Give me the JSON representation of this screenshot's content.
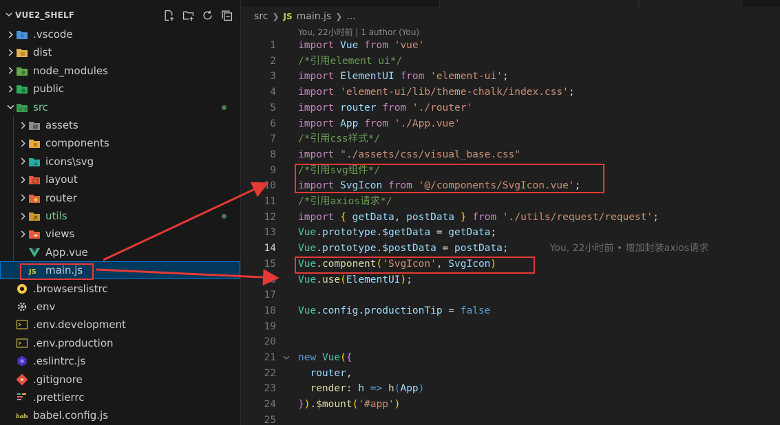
{
  "explorer": {
    "title": "VUE2_SHELF",
    "actions": [
      "new-file-icon",
      "new-folder-icon",
      "refresh-icon",
      "collapse-all-icon"
    ],
    "items": [
      {
        "label": ".vscode",
        "icon": "vscode-folder-icon",
        "twisty": "closed",
        "indent": 0
      },
      {
        "label": "dist",
        "icon": "dist-folder-icon",
        "twisty": "closed",
        "indent": 0
      },
      {
        "label": "node_modules",
        "icon": "node-folder-icon",
        "twisty": "closed",
        "indent": 0
      },
      {
        "label": "public",
        "icon": "public-folder-icon",
        "twisty": "closed",
        "indent": 0
      },
      {
        "label": "src",
        "icon": "src-folder-icon",
        "twisty": "open",
        "indent": 0,
        "modified": true
      },
      {
        "label": "assets",
        "icon": "assets-folder-icon",
        "twisty": "closed",
        "indent": 1
      },
      {
        "label": "components",
        "icon": "components-folder-icon",
        "twisty": "closed",
        "indent": 1
      },
      {
        "label": "icons\\svg",
        "icon": "icons-folder-icon",
        "twisty": "closed",
        "indent": 1
      },
      {
        "label": "layout",
        "icon": "layout-folder-icon",
        "twisty": "closed",
        "indent": 1
      },
      {
        "label": "router",
        "icon": "router-folder-icon",
        "twisty": "closed",
        "indent": 1
      },
      {
        "label": "utils",
        "icon": "utils-folder-icon",
        "twisty": "closed",
        "indent": 1,
        "modified": true
      },
      {
        "label": "views",
        "icon": "views-folder-icon",
        "twisty": "closed",
        "indent": 1
      },
      {
        "label": "App.vue",
        "icon": "vue-file-icon",
        "twisty": "none",
        "indent": 1
      },
      {
        "label": "main.js",
        "icon": "js-file-icon",
        "twisty": "none",
        "indent": 1,
        "selected": true
      },
      {
        "label": ".browserslistrc",
        "icon": "browserslist-file-icon",
        "twisty": "none",
        "indent": 0
      },
      {
        "label": ".env",
        "icon": "gear-icon",
        "twisty": "none",
        "indent": 0
      },
      {
        "label": ".env.development",
        "icon": "terminal-file-icon",
        "twisty": "none",
        "indent": 0
      },
      {
        "label": ".env.production",
        "icon": "terminal-file-icon",
        "twisty": "none",
        "indent": 0
      },
      {
        "label": ".eslintrc.js",
        "icon": "eslint-file-icon",
        "twisty": "none",
        "indent": 0
      },
      {
        "label": ".gitignore",
        "icon": "git-file-icon",
        "twisty": "none",
        "indent": 0
      },
      {
        "label": ".prettierrc",
        "icon": "prettier-file-icon",
        "twisty": "none",
        "indent": 0
      },
      {
        "label": "babel.config.js",
        "icon": "babel-file-icon",
        "twisty": "none",
        "indent": 0
      }
    ]
  },
  "breadcrumb": {
    "folder": "src",
    "file_badge": "JS",
    "file": "main.js",
    "more": "..."
  },
  "codelens": "You, 22小时前 | 1 author (You)",
  "blame": "You, 22小时前 • 增加封装axios请求",
  "code": [
    {
      "n": "1",
      "tokens": [
        [
          "kw",
          "import"
        ],
        [
          "pl",
          " "
        ],
        [
          "vr",
          "Vue"
        ],
        [
          "pl",
          " "
        ],
        [
          "kw",
          "from"
        ],
        [
          "pl",
          " "
        ],
        [
          "st",
          "'vue'"
        ]
      ]
    },
    {
      "n": "2",
      "tokens": [
        [
          "cm",
          "/*引用element ui*/"
        ]
      ]
    },
    {
      "n": "3",
      "tokens": [
        [
          "kw",
          "import"
        ],
        [
          "pl",
          " "
        ],
        [
          "vr",
          "ElementUI"
        ],
        [
          "pl",
          " "
        ],
        [
          "kw",
          "from"
        ],
        [
          "pl",
          " "
        ],
        [
          "st",
          "'element-ui'"
        ],
        [
          "pl",
          ";"
        ]
      ]
    },
    {
      "n": "4",
      "tokens": [
        [
          "kw",
          "import"
        ],
        [
          "pl",
          " "
        ],
        [
          "st",
          "'element-ui/lib/theme-chalk/index.css'"
        ],
        [
          "pl",
          ";"
        ]
      ]
    },
    {
      "n": "5",
      "tokens": [
        [
          "kw",
          "import"
        ],
        [
          "pl",
          " "
        ],
        [
          "vr",
          "router"
        ],
        [
          "pl",
          " "
        ],
        [
          "kw",
          "from"
        ],
        [
          "pl",
          " "
        ],
        [
          "st",
          "'./router'"
        ]
      ]
    },
    {
      "n": "6",
      "tokens": [
        [
          "kw",
          "import"
        ],
        [
          "pl",
          " "
        ],
        [
          "vr",
          "App"
        ],
        [
          "pl",
          " "
        ],
        [
          "kw",
          "from"
        ],
        [
          "pl",
          " "
        ],
        [
          "st",
          "'./App.vue'"
        ]
      ]
    },
    {
      "n": "7",
      "tokens": [
        [
          "cm",
          "/*引用css样式*/"
        ]
      ]
    },
    {
      "n": "8",
      "tokens": [
        [
          "kw",
          "import"
        ],
        [
          "pl",
          " "
        ],
        [
          "st",
          "\"./assets/css/visual_base.css\""
        ]
      ]
    },
    {
      "n": "9",
      "tokens": [
        [
          "cm",
          "/*引用svg组件*/"
        ]
      ]
    },
    {
      "n": "10",
      "tokens": [
        [
          "kw",
          "import"
        ],
        [
          "pl",
          " "
        ],
        [
          "vr",
          "SvgIcon"
        ],
        [
          "pl",
          " "
        ],
        [
          "kw",
          "from"
        ],
        [
          "pl",
          " "
        ],
        [
          "st",
          "'@/components/SvgIcon.vue'"
        ],
        [
          "pl",
          ";"
        ]
      ]
    },
    {
      "n": "11",
      "tokens": [
        [
          "cm",
          "/*引用axios请求*/"
        ]
      ]
    },
    {
      "n": "12",
      "tokens": [
        [
          "kw",
          "import"
        ],
        [
          "pl",
          " "
        ],
        [
          "bk",
          "{"
        ],
        [
          "pl",
          " "
        ],
        [
          "vr",
          "getData"
        ],
        [
          "pl",
          ", "
        ],
        [
          "vr",
          "postData"
        ],
        [
          "pl",
          " "
        ],
        [
          "bk",
          "}"
        ],
        [
          "pl",
          " "
        ],
        [
          "kw",
          "from"
        ],
        [
          "pl",
          " "
        ],
        [
          "st",
          "'./utils/request/request'"
        ],
        [
          "pl",
          ";"
        ]
      ]
    },
    {
      "n": "13",
      "tokens": [
        [
          "cl",
          "Vue"
        ],
        [
          "pl",
          "."
        ],
        [
          "vr",
          "prototype"
        ],
        [
          "pl",
          "."
        ],
        [
          "vr",
          "$getData"
        ],
        [
          "pl",
          " = "
        ],
        [
          "vr",
          "getData"
        ],
        [
          "pl",
          ";"
        ]
      ]
    },
    {
      "n": "14",
      "current": true,
      "tokens": [
        [
          "cl",
          "Vue"
        ],
        [
          "pl",
          "."
        ],
        [
          "vr",
          "prototype"
        ],
        [
          "pl",
          "."
        ],
        [
          "vr",
          "$postData"
        ],
        [
          "pl",
          " = "
        ],
        [
          "vr",
          "postData"
        ],
        [
          "pl",
          ";"
        ]
      ]
    },
    {
      "n": "15",
      "tokens": [
        [
          "cl",
          "Vue"
        ],
        [
          "pl",
          "."
        ],
        [
          "fn",
          "component"
        ],
        [
          "bk",
          "("
        ],
        [
          "st",
          "'SvgIcon'"
        ],
        [
          "pl",
          ", "
        ],
        [
          "vr",
          "SvgIcon"
        ],
        [
          "bk",
          ")"
        ]
      ]
    },
    {
      "n": "16",
      "tokens": [
        [
          "cl",
          "Vue"
        ],
        [
          "pl",
          "."
        ],
        [
          "fn",
          "use"
        ],
        [
          "bk",
          "("
        ],
        [
          "vr",
          "ElementUI"
        ],
        [
          "bk",
          ")"
        ],
        [
          "pl",
          ";"
        ]
      ]
    },
    {
      "n": "17",
      "tokens": []
    },
    {
      "n": "18",
      "tokens": [
        [
          "cl",
          "Vue"
        ],
        [
          "pl",
          "."
        ],
        [
          "vr",
          "config"
        ],
        [
          "pl",
          "."
        ],
        [
          "vr",
          "productionTip"
        ],
        [
          "pl",
          " = "
        ],
        [
          "kb",
          "false"
        ]
      ]
    },
    {
      "n": "19",
      "tokens": []
    },
    {
      "n": "20",
      "tokens": []
    },
    {
      "n": "21",
      "fold": true,
      "tokens": [
        [
          "kb",
          "new"
        ],
        [
          "pl",
          " "
        ],
        [
          "cl",
          "Vue"
        ],
        [
          "bk",
          "("
        ],
        [
          "bk2",
          "{"
        ]
      ]
    },
    {
      "n": "22",
      "tokens": [
        [
          "pl",
          "  "
        ],
        [
          "vr",
          "router"
        ],
        [
          "pl",
          ","
        ]
      ]
    },
    {
      "n": "23",
      "tokens": [
        [
          "pl",
          "  "
        ],
        [
          "fn",
          "render"
        ],
        [
          "pl",
          ": "
        ],
        [
          "vr",
          "h"
        ],
        [
          "pl",
          " "
        ],
        [
          "kb",
          "=>"
        ],
        [
          "pl",
          " "
        ],
        [
          "fn",
          "h"
        ],
        [
          "bk3",
          "("
        ],
        [
          "vr",
          "App"
        ],
        [
          "bk3",
          ")"
        ]
      ]
    },
    {
      "n": "24",
      "tokens": [
        [
          "bk2",
          "}"
        ],
        [
          "bk",
          ")"
        ],
        [
          "pl",
          "."
        ],
        [
          "fn",
          "$mount"
        ],
        [
          "bk",
          "("
        ],
        [
          "st",
          "'#app'"
        ],
        [
          "bk",
          ")"
        ]
      ]
    },
    {
      "n": "25",
      "tokens": []
    }
  ],
  "colors": {
    "annotation": "#e53935",
    "selection": "#04395e",
    "modified": "#73c991"
  }
}
